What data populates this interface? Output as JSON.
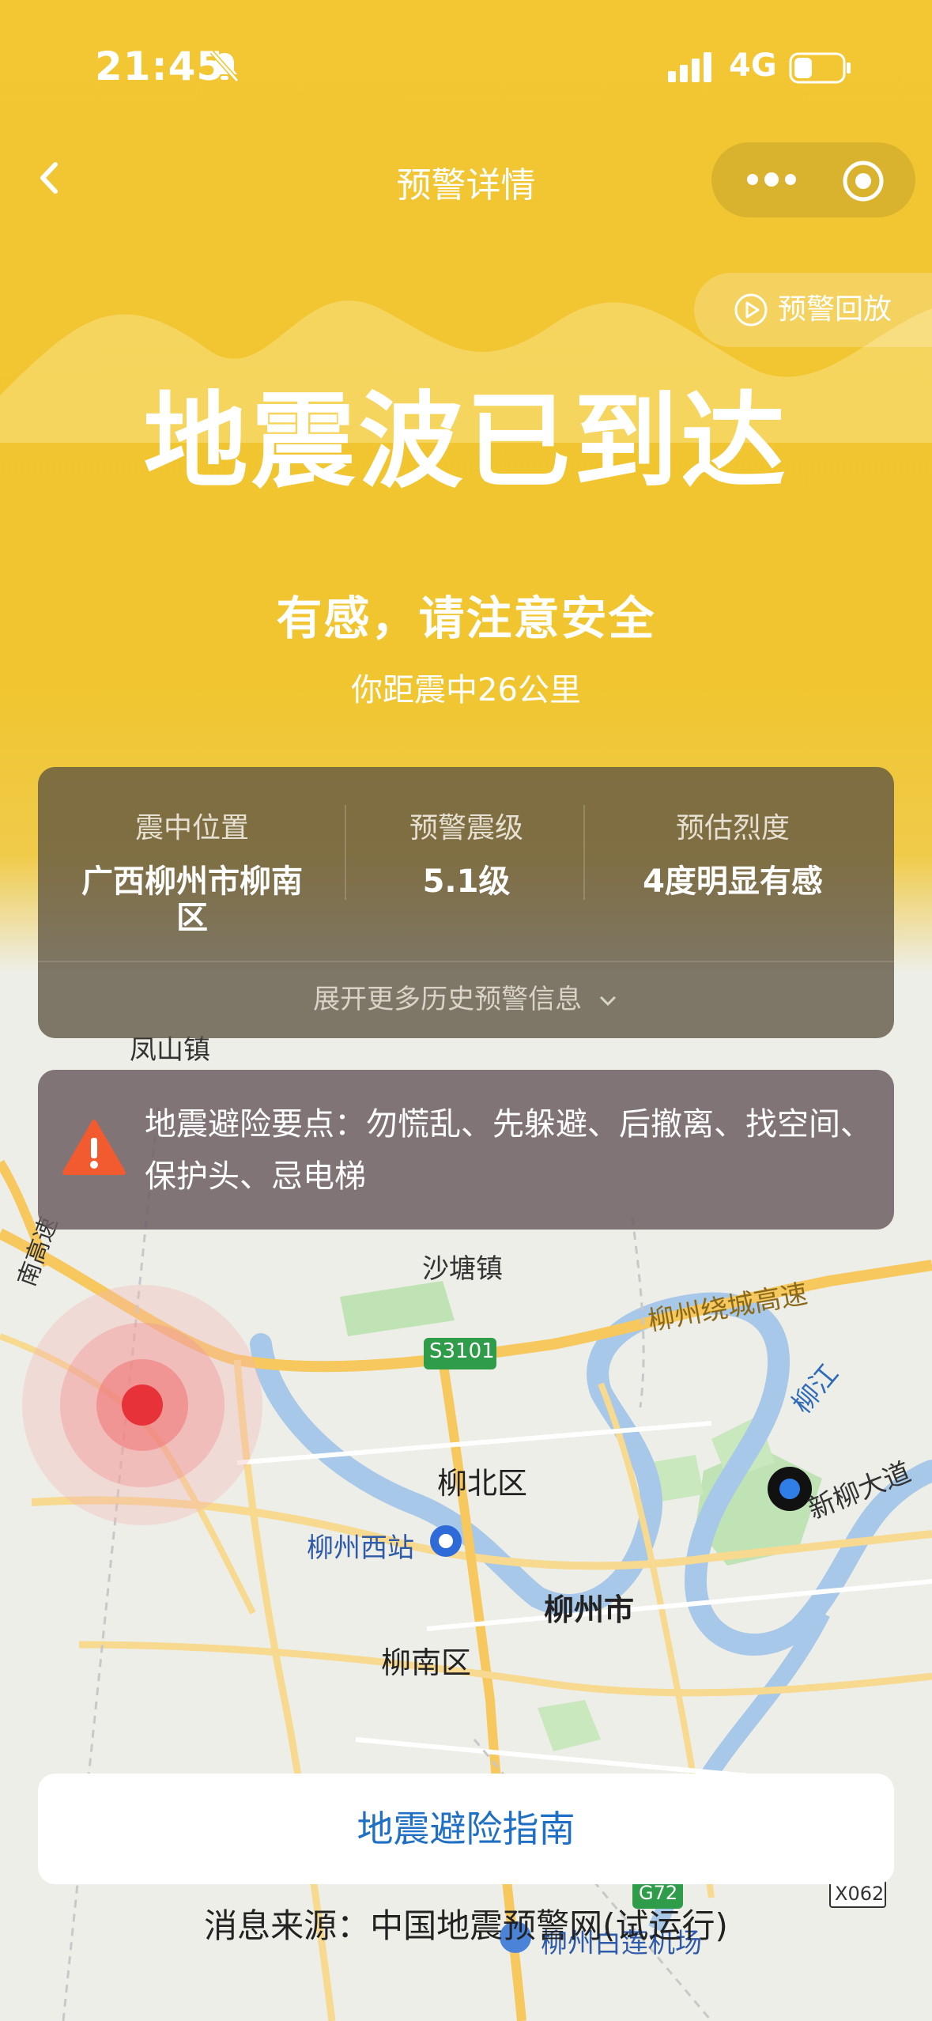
{
  "status": {
    "time": "21:45",
    "network": "4G"
  },
  "nav": {
    "title": "预警详情"
  },
  "replay_label": "预警回放",
  "headline": "地震波已到达",
  "subheadline": "有感，请注意安全",
  "distance_text": "你距震中26公里",
  "info": {
    "epicenter_label": "震中位置",
    "epicenter_value": "广西柳州市柳南区",
    "magnitude_label": "预警震级",
    "magnitude_value": "5.1级",
    "intensity_label": "预估烈度",
    "intensity_value": "4度明显有感",
    "expand_label": "展开更多历史预警信息"
  },
  "tips": {
    "text": "地震避险要点：勿慌乱、先躲避、后撤离、找空间、保护头、忌电梯"
  },
  "guide_button": "地震避险指南",
  "source": "消息来源：中国地震预警网(试运行)",
  "map": {
    "labels": {
      "fengshan": "凤山镇",
      "shatang": "沙塘镇",
      "s3101": "S3101",
      "ring_highway": "柳州绕城高速",
      "liujiang": "柳江",
      "liubei": "柳北区",
      "xinliu": "新柳大道",
      "west_station": "柳州西站",
      "liuzhou_city": "柳州市",
      "liunan": "柳南区",
      "g72": "G72",
      "x062": "X062",
      "airport": "柳州白莲机场",
      "nangao": "南高速"
    }
  },
  "colors": {
    "accent_yellow": "#F0C52F",
    "epicenter_red": "#E8323A",
    "link_blue": "#1F6FC5"
  }
}
